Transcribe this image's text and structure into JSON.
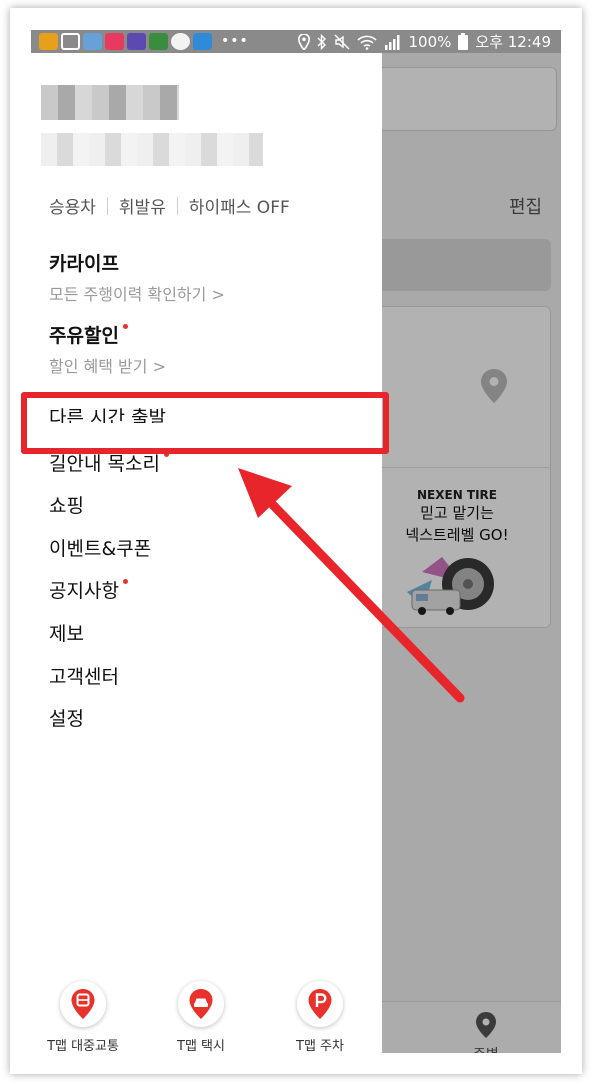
{
  "status_bar": {
    "battery": "100%",
    "time": "오후 12:49",
    "overflow": "•••"
  },
  "drawer": {
    "chips": [
      "승용차",
      "휘발유",
      "하이패스 OFF"
    ],
    "karlife": {
      "title": "카라이프",
      "sub": "모든 주행이력 확인하기 >"
    },
    "fuel_discount": {
      "title": "주유할인",
      "sub": "할인 혜택 받기 >"
    },
    "menu": [
      "다른 시간 출발",
      "길안내 목소리",
      "쇼핑",
      "이벤트&쿠폰",
      "공지사항",
      "제보",
      "고객센터",
      "설정"
    ],
    "quick_actions": [
      {
        "label": "T맵 대중교통",
        "icon": "bus-icon"
      },
      {
        "label": "T맵 택시",
        "icon": "taxi-icon"
      },
      {
        "label": "T맵 주차",
        "icon": "parking-icon"
      }
    ]
  },
  "background": {
    "edit_label": "편집",
    "ad": {
      "brand": "NEXEN TIRE",
      "line1": "믿고 맡기는",
      "line2": "넥스트레벨 GO!"
    },
    "nearby_label": "주변"
  },
  "colors": {
    "accent_red": "#e8322c",
    "annotation_red": "#e8252b",
    "dim_overlay": "rgba(0,0,0,0.30)"
  }
}
